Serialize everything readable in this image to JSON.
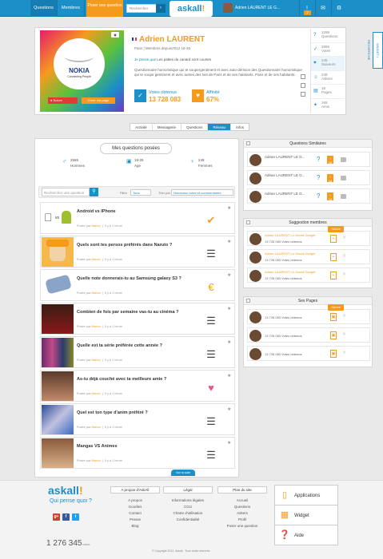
{
  "topbar": {
    "nav": [
      "Questions",
      "Membres"
    ],
    "pose_label": "Poser une question",
    "search_placeholder": "Rechercher",
    "search_go": "›",
    "logo_main": "askall",
    "logo_accent": "!",
    "user_name": "Adrien LAURENT LE G...",
    "notif_count": "2"
  },
  "sidewidget": {
    "label": "WIDGET / RECHERCHE"
  },
  "profile": {
    "brand_word": "NOKIA",
    "brand_sub": "Connecting People",
    "follow_label": "Suivre",
    "page_label": "Créer ma page",
    "name": "Adrien LAURENT",
    "meta": "Paris | Membres depuis2012 18-25",
    "status_prefix": "Je pense que",
    "status_text": "Les pattes de canard sont courtes",
    "bio": "Questionnaire humoristique qui te soupergentiment et avec auto-dérision des Questionnaire humoristique qui te soupe gentiment et avec autres des lost de Paris et de ses habitants. Paris et de ses habitants.",
    "votes_label": "Votes obtenus",
    "votes_value": "13 728 083",
    "affinity_label": "Affinité",
    "affinity_value": "67%",
    "side_stats": [
      {
        "num": "1265",
        "label": "Questions",
        "icon": "?"
      },
      {
        "num": "2565",
        "label": "Votes",
        "icon": "✓"
      },
      {
        "num": "245",
        "label": "Suiveurs",
        "icon": "♥"
      },
      {
        "num": "248",
        "label": "Askers",
        "icon": "☺"
      },
      {
        "num": "18",
        "label": "Pages",
        "icon": "▤"
      },
      {
        "num": "165",
        "label": "Amis",
        "icon": "✦"
      }
    ]
  },
  "tabs": [
    "Activité",
    "Messagerie",
    "Questions",
    "Réseau",
    "Infos"
  ],
  "active_tab": "Réseau",
  "main": {
    "title": "Mes questions posées",
    "demographics": [
      {
        "icon": "♂",
        "value": "2565",
        "label": "Hommes"
      },
      {
        "icon": "▣",
        "value": "18-25",
        "label": "Age"
      },
      {
        "icon": "♀",
        "value": "248",
        "label": "Femmes"
      }
    ],
    "filter": {
      "search_placeholder": "Rechercher une question",
      "filtre_label": "Filtre",
      "filtre_value": "Tous",
      "tri_label": "Trier par",
      "tri_value": "Nouveaux votes et commentaires"
    },
    "questions": [
      {
        "title": "Android vs IPhone",
        "author": "Marclo",
        "time": "Il y a 1 heure",
        "icon": "✔"
      },
      {
        "title": "Quels sont tes persos préférés dans Naruto ?",
        "author": "Marclo",
        "time": "Il y a 1 heure",
        "icon": "☰"
      },
      {
        "title": "Quelle note donnerais-tu au Samsung galaxy S3 ?",
        "author": "Marclo",
        "time": "Il y a 1 heure",
        "icon": "€"
      },
      {
        "title": "Combien de fois par semaine vas-tu au cinéma ?",
        "author": "Marclo",
        "time": "Il y a 1 heure",
        "icon": "☰"
      },
      {
        "title": "Quelle est ta série préférée cette année ?",
        "author": "Marclo",
        "time": "Il y a 1 heure",
        "icon": "☰"
      },
      {
        "title": "As-tu déjà couché avec ta meilleure amie ?",
        "author": "Marclo",
        "time": "Il y a 1 heure",
        "icon": "♥"
      },
      {
        "title": "Quel est ton type d'anim préféré ?",
        "author": "Marclo",
        "time": "Il y a 1 heure",
        "icon": "☰"
      },
      {
        "title": "Mangas VS Animes",
        "author": "Marclo",
        "time": "Il y a 1 heure",
        "icon": "☰"
      }
    ],
    "posted_by": "Posée par",
    "more_label": "Voir la suite"
  },
  "similar": {
    "title": "Questions Similaires",
    "rows": [
      {
        "name": "Adrian LAURENT LE G..."
      },
      {
        "name": "Adrian LAURENT LE G..."
      },
      {
        "name": "Adrian LAURENT LE G..."
      }
    ],
    "badge": "18"
  },
  "suggest": {
    "title": "Suggestion membres",
    "follow": "Suivre",
    "rows": [
      {
        "name": "Adrian LAURENT Le Grand Gadget",
        "votes": "13 728 083 Votes obtenus"
      },
      {
        "name": "Adrian LAURENT Le Grand Gadget",
        "votes": "13 728 083 Votes obtenus"
      },
      {
        "name": "Adrian LAURENT Le Grand Gadget",
        "votes": "13 728 083 Votes obtenus"
      }
    ]
  },
  "pages": {
    "title": "Ses Pages",
    "follow": "Suivre",
    "rows": [
      {
        "votes": "13 728 083 Votes obtenus"
      },
      {
        "votes": "13 728 083 Votes obtenus"
      },
      {
        "votes": "13 728 083 Votes obtenus"
      }
    ]
  },
  "footer": {
    "logo_main": "askall",
    "logo_accent": "!",
    "tagline": "Qui pense quoi ?",
    "social": [
      "g+",
      "f",
      "t"
    ],
    "count": "1 276 345",
    "count_label": "votes",
    "cols": [
      {
        "title": "A propos d'AskAll",
        "items": [
          "A propos",
          "Goodies",
          "Contact",
          "Presse",
          "Blog"
        ]
      },
      {
        "title": "Légal",
        "items": [
          "Informations légales",
          "CGU",
          "Charte d'utilisation",
          "Confidentialité"
        ]
      },
      {
        "title": "Plan du site",
        "items": [
          "Accueil",
          "Questions",
          "Askers",
          "Profil",
          "Poser une question"
        ]
      }
    ],
    "apps": [
      "Applications",
      "Widget",
      "Aide"
    ],
    "copyright": "© Copyright 2012, Askall . Tous droits réservés"
  },
  "colors": {
    "brand_blue": "#1a8fc8",
    "brand_orange": "#f49b1e",
    "follow_red": "#e53935"
  }
}
